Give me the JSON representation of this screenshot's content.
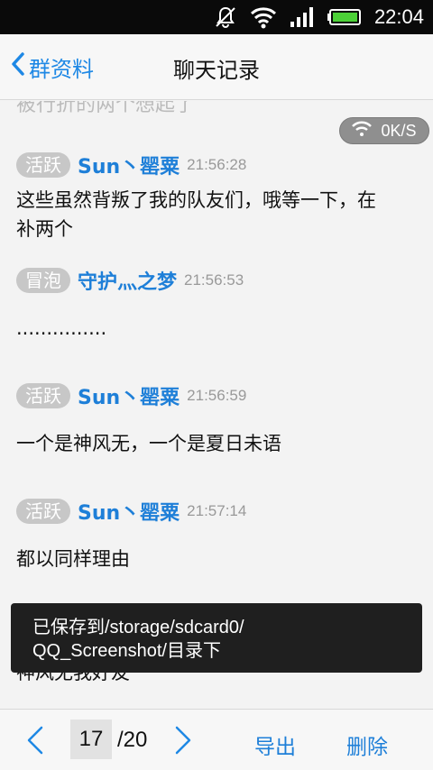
{
  "status_bar": {
    "time": "22:04"
  },
  "title_bar": {
    "back_label": "群资料",
    "title": "聊天记录"
  },
  "top_fragment": "被行折的两个想起了",
  "speed_indicator": "0K/S",
  "messages": [
    {
      "badge": "活跃",
      "nickname": "Sun丶罂粟",
      "time": "21:56:28",
      "text": "这些虽然背叛了我的队友们，哦等一下，在补两个"
    },
    {
      "badge": "冒泡",
      "nickname": "守护灬之梦",
      "time": "21:56:53",
      "text": "..............."
    },
    {
      "badge": "活跃",
      "nickname": "Sun丶罂粟",
      "time": "21:56:59",
      "text": "一个是神风无，一个是夏日未语"
    },
    {
      "badge": "活跃",
      "nickname": "Sun丶罂粟",
      "time": "21:57:14",
      "text": "都以同样理由"
    }
  ],
  "partial_message": "神风无我好友",
  "toast": {
    "line1": "已保存到/storage/sdcard0/",
    "line2": "QQ_Screenshot/目录下"
  },
  "bottom_bar": {
    "current_page": "17",
    "total_pages": "/20",
    "export_label": "导出",
    "delete_label": "删除"
  },
  "colors": {
    "accent": "#1e7fd8",
    "badge": "#c7c7c7",
    "toast_bg": "#1f1f1f"
  }
}
